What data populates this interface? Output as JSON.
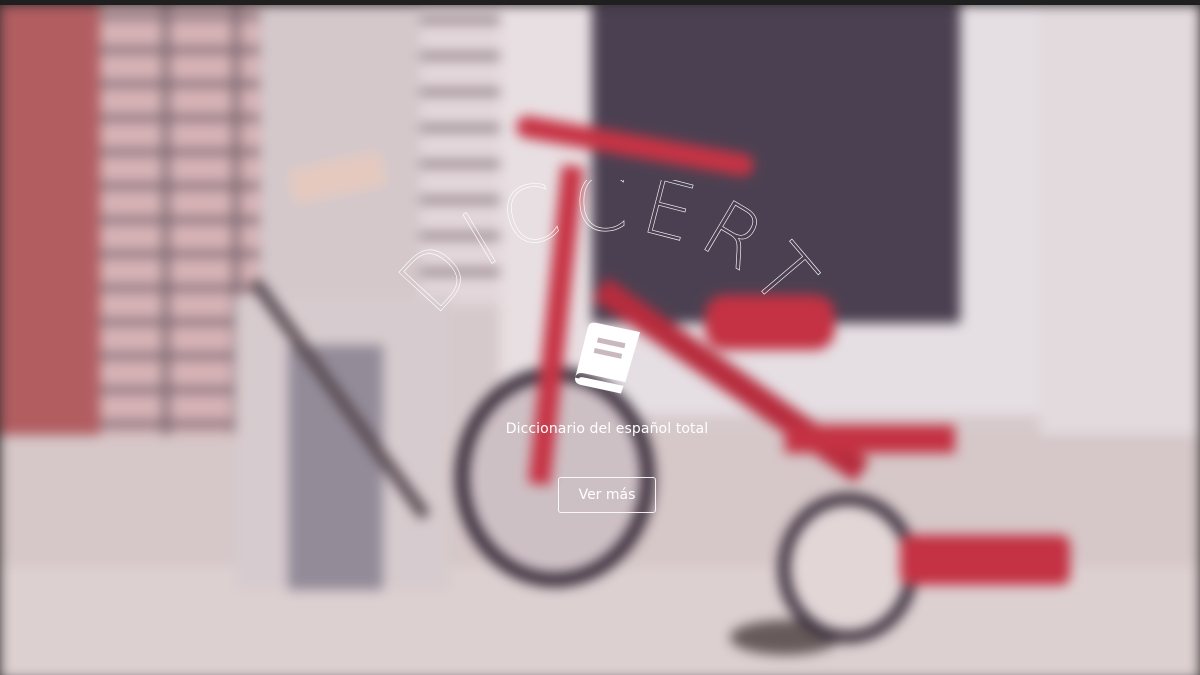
{
  "hero": {
    "logo_text": "DICCERT",
    "tagline": "Diccionario del español total",
    "cta_label": "Ver más",
    "logo_icon": "book-icon"
  },
  "colors": {
    "text": "#ffffff",
    "button_border": "#ffffff",
    "bike_red": "#c42638"
  }
}
